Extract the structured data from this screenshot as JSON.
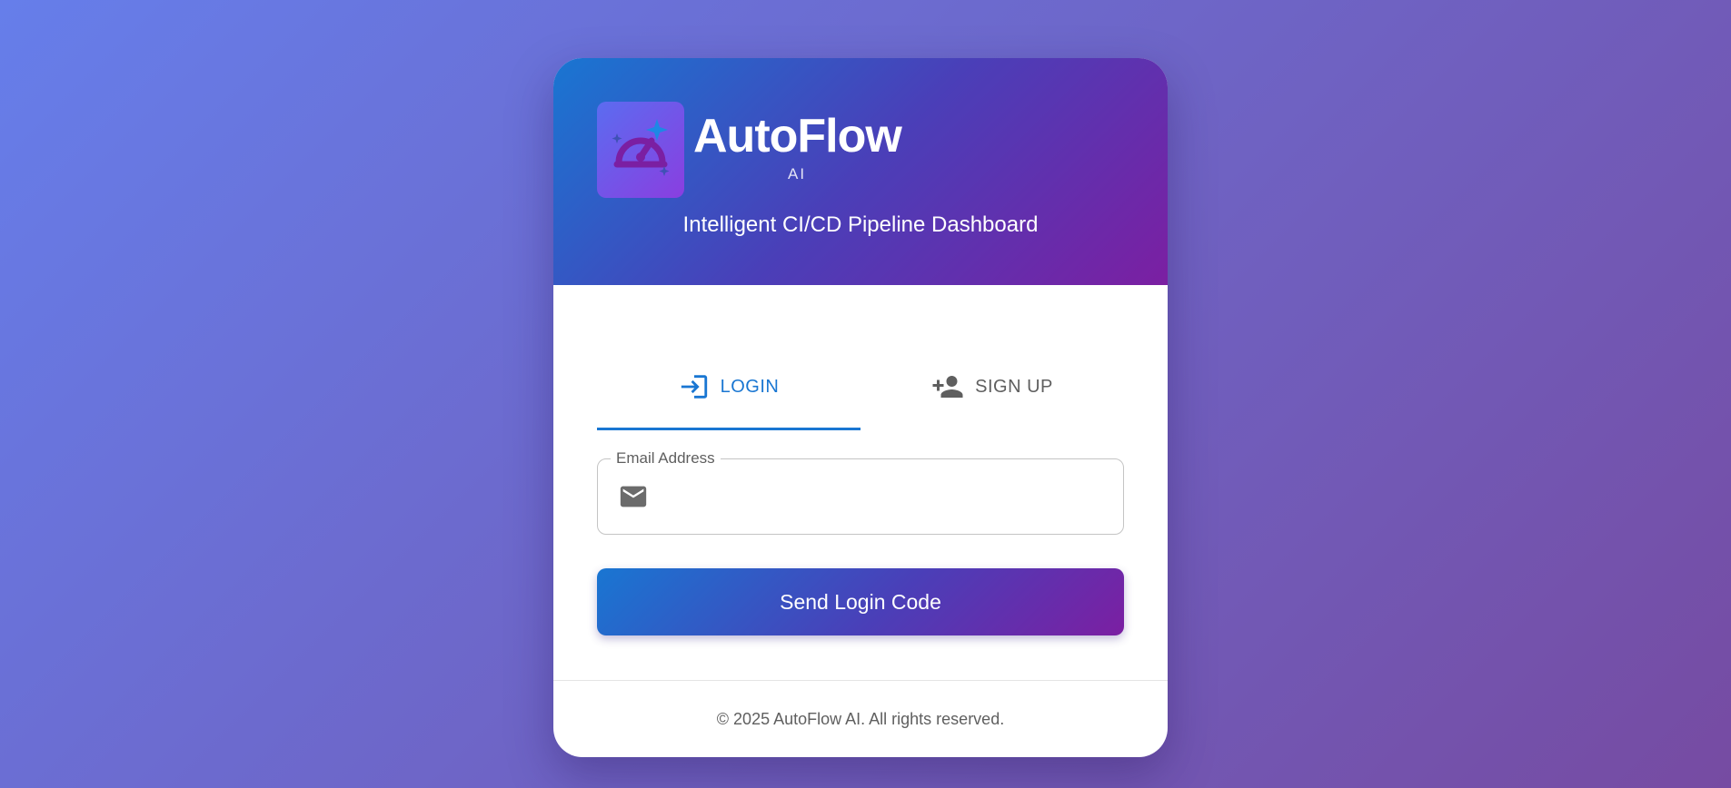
{
  "brand": {
    "name": "AutoFlow",
    "sub": "AI",
    "tagline": "Intelligent CI/CD Pipeline Dashboard",
    "logo_icon": "speedometer-sparkle-icon"
  },
  "tabs": [
    {
      "label": "LOGIN",
      "icon": "login-icon",
      "active": true
    },
    {
      "label": "SIGN UP",
      "icon": "person-add-icon",
      "active": false
    }
  ],
  "form": {
    "email_label": "Email Address",
    "email_value": "",
    "email_icon": "mail-icon",
    "submit_label": "Send Login Code"
  },
  "footer": {
    "text": "© 2025 AutoFlow AI. All rights reserved."
  },
  "colors": {
    "primary": "#1976d2",
    "secondary": "#7b1fa2",
    "background_start": "#667eea",
    "background_end": "#764ba2"
  }
}
